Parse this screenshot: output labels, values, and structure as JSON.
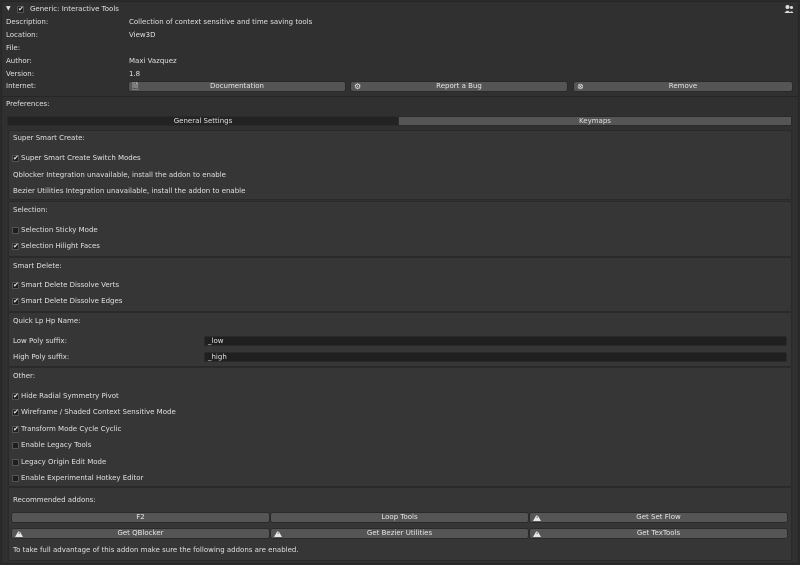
{
  "header": {
    "title": "Generic: Interactive Tools",
    "expand_glyph": "▼",
    "user_icon": "user-icon"
  },
  "info": {
    "description_label": "Description:",
    "description_value": "Collection of context sensitive and time saving tools",
    "location_label": "Location:",
    "location_value": "View3D",
    "file_label": "File:",
    "author_label": "Author:",
    "author_value": "Maxi Vazquez",
    "version_label": "Version:",
    "version_value": "1.8",
    "internet_label": "Internet:",
    "documentation_label": "Documentation",
    "report_bug_label": "Report a Bug",
    "remove_label": "Remove"
  },
  "preferences_label": "Preferences:",
  "tabs": {
    "general": "General Settings",
    "keymaps": "Keymaps"
  },
  "super_smart_create": {
    "title": "Super Smart Create:",
    "switch_modes": "Super Smart Create Switch Modes",
    "switch_modes_checked": true,
    "qblocker_note": "Qblocker Integration unavailable, install the addon to enable",
    "bezier_note": "Bezier Utilities Integration unavailable, install the addon to enable"
  },
  "selection": {
    "title": "Selection:",
    "sticky_mode": "Selection Sticky Mode",
    "sticky_mode_checked": false,
    "hilight_faces": "Selection Hilight Faces",
    "hilight_faces_checked": true
  },
  "smart_delete": {
    "title": "Smart Delete:",
    "dissolve_verts": "Smart Delete Dissolve Verts",
    "dissolve_verts_checked": true,
    "dissolve_edges": "Smart Delete Dissolve Edges",
    "dissolve_edges_checked": true
  },
  "quick_lp_hp": {
    "title": "Quick Lp Hp Name:",
    "low_label": "Low Poly suffix:",
    "low_value": "_low",
    "high_label": "High Poly suffix:",
    "high_value": "_high"
  },
  "other": {
    "title": "Other:",
    "radial_symmetry": "Hide Radial Symmetry Pivot",
    "radial_symmetry_checked": true,
    "wireframe_shaded": "Wireframe / Shaded Context Sensitive Mode",
    "wireframe_shaded_checked": true,
    "transform_cycle": "Transform Mode Cycle Cyclic",
    "transform_cycle_checked": true,
    "legacy_tools": "Enable Legacy Tools",
    "legacy_tools_checked": false,
    "legacy_origin": "Legacy Origin Edit Mode",
    "legacy_origin_checked": false,
    "hotkey_editor": "Enable Experimental Hotkey Editor",
    "hotkey_editor_checked": false
  },
  "recommended": {
    "title": "Recommended addons:",
    "f2": "F2",
    "loop_tools": "Loop Tools",
    "set_flow": "Get Set Flow",
    "qblocker": "Get QBlocker",
    "bezier_utilities": "Get Bezier Utilities",
    "textools": "Get TexTools",
    "footer_note": "To take full advantage of this addon make sure the following addons are enabled."
  },
  "colors": {
    "background": "#2b2b2b",
    "panel": "#363636",
    "button": "#555555",
    "field": "#1f1f1f",
    "tab_active": "#232323",
    "tab_inactive": "#555555",
    "text": "#e0e0e0"
  }
}
